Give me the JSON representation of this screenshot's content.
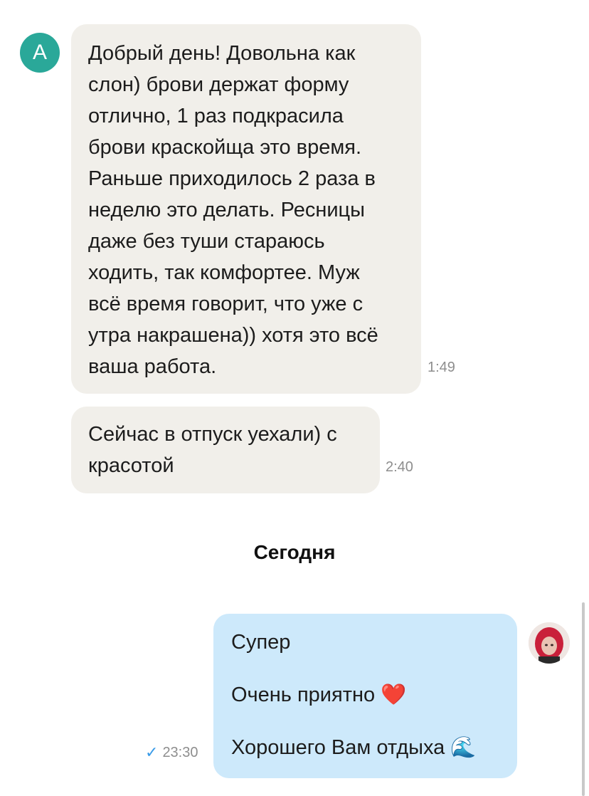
{
  "messages": [
    {
      "direction": "incoming",
      "avatar_letter": "A",
      "lines": [
        "Добрый день! Довольна как",
        "слон) брови держат форму",
        "отлично, 1 раз подкрасила",
        "брови краскойща это время.",
        "Раньше приходилось 2 раза в",
        "неделю это делать. Ресницы",
        "даже без туши стараюсь",
        "ходить, так комфортее. Муж",
        "всё время говорит, что уже с",
        "утра накрашена)) хотя это всё",
        "ваша работа."
      ],
      "time": "1:49"
    },
    {
      "direction": "incoming",
      "lines": [
        "Сейчас в отпуск уехали) с",
        "красотой"
      ],
      "time": "2:40"
    }
  ],
  "day_separator": "Сегодня",
  "outgoing": {
    "lines": [
      "Супер",
      "Очень приятно ❤️",
      "Хорошего Вам отдыха 🌊"
    ],
    "time": "23:30",
    "status": "sent-check"
  },
  "colors": {
    "incoming_bubble": "#f1efea",
    "outgoing_bubble": "#cde9fb",
    "avatar_a": "#2aa899",
    "check": "#3a9be8"
  }
}
